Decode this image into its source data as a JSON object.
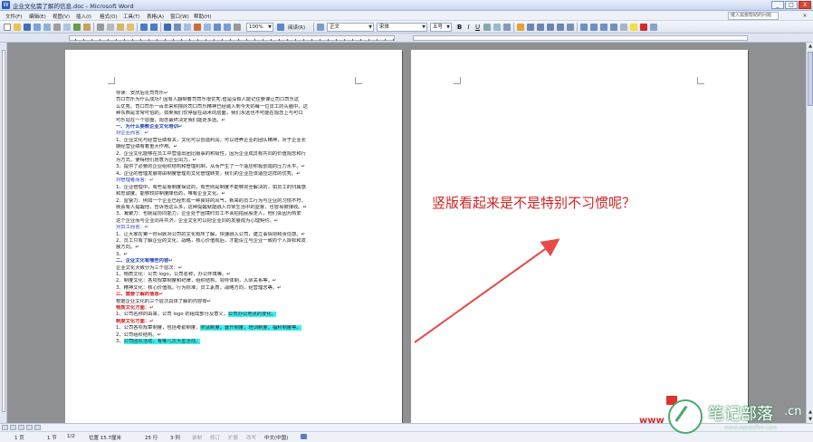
{
  "window": {
    "title": "企业文化需了解的信息.doc - Microsoft Word",
    "minimize": "_",
    "maximize": "□",
    "close": "X"
  },
  "menubar": {
    "items": [
      "文件(F)",
      "编辑(E)",
      "视图(V)",
      "插入(I)",
      "格式(O)",
      "工具(T)",
      "表格(A)",
      "窗口(W)",
      "帮助(H)"
    ],
    "help_placeholder": "键入需要帮助的问题",
    "close": "×"
  },
  "toolbar": {
    "zoom": "100%",
    "read_mode": "阅读(R)",
    "style": "正文",
    "font": "宋体",
    "size": "五号",
    "bold": "B",
    "italic": "I",
    "underline": "U"
  },
  "document": {
    "lines": [
      {
        "text": "导读：安庆后论司司乐↵",
        "style": "normal"
      },
      {
        "text": "司口司乐为什么成功? 因有人翻制着司司乐很优秀,但是没有人能记住要谨让司口司乐这",
        "style": "normal"
      },
      {
        "text": "么优秀。司口司乐一百年来积攒的司口司乐精神已经融入到今天的每一位员工的头脑中，这",
        "style": "normal"
      },
      {
        "text": "种东西是非常可怕的。如果我们仅停留在战术的层面，我们永远也不可能在观念上与可口",
        "style": "normal"
      },
      {
        "text": "可乐站在一个层面，观念最终决定我们能走多远。↵",
        "style": "normal"
      },
      {
        "text": "一、为什么要教企业文化培训↵",
        "style": "heading"
      },
      {
        "text": "对企业而言：↵",
        "style": "subheading"
      },
      {
        "text": "1、企业文化与经营业绩有关，文化可以创造利润，可以培养企业的团队精神，对于企业长",
        "style": "normal"
      },
      {
        "text": "期经营业绩有着重大作用。↵",
        "style": "normal"
      },
      {
        "text": "2、企业文化能够在员工中营造出团比服事的积极性，因为企业成员有共同的价值观念和行",
        "style": "normal"
      },
      {
        "text": "为方式，使得他们愿意为企业出力。↵",
        "style": "normal"
      },
      {
        "text": "3、提供了必要的企业组织结构和管理机制，从而产生了一个适应积极创造的压力水平。↵",
        "style": "normal"
      },
      {
        "text": "4、企业的管理发展将由制度管理向文化管理转变，我们的企业应该适应这样的优秀。↵",
        "style": "normal"
      },
      {
        "text": "对管理者而言：↵",
        "style": "subheading"
      },
      {
        "text": "1、企业管理中，有些是靠制度保证的，有些则是制度不能够完全解决的，如员工的归属感",
        "style": "normal"
      },
      {
        "text": "和忠诚度。能够较好制度降低的，唯有企业文化。↵",
        "style": "normal"
      },
      {
        "text": "2、监督力：例如一个企业已经形成一种良好的风气，新来的员工行为与企业的习惯不符，",
        "style": "normal"
      },
      {
        "text": "就会有人提醒他，告诉他这么多，这种提醒就能融入日常生活中的监督，也容易被接收。↵",
        "style": "normal"
      },
      {
        "text": "3、凝聚力：也就是协同能力，企业处于困境时员工不会拍拍屁股走人，他们会因为热爱",
        "style": "normal"
      },
      {
        "text": "这个企业而与企业同舟共济，企业文化可以把企业同的发展成为心理契约。↵",
        "style": "normal"
      },
      {
        "text": "对员工而言：↵",
        "style": "subheading"
      },
      {
        "text": "1、让大家在第一时间就对公司的文化有所了解，快速融入公司，建立事情把和责任感。↵",
        "style": "normal"
      },
      {
        "text": "2、员工只有了解企业的文化，战略，核心价值观后，才能设立与企业一致的个人目标和发",
        "style": "normal"
      },
      {
        "text": "展方向。↵",
        "style": "normal"
      },
      {
        "text": "3、↵",
        "style": "normal"
      },
      {
        "text": "二、企业文化有哪些内容↵",
        "style": "heading"
      },
      {
        "text": "企业文化大致分为三个层次：↵",
        "style": "normal"
      },
      {
        "text": "1、物质文化：公司 logo，公司名称，办公环境等。↵",
        "style": "normal"
      },
      {
        "text": "2、制度文化：各项规章制度和纪律，组织结构，领导体制，人际关系等。↵",
        "style": "normal"
      },
      {
        "text": "3、精神文化：核心价值观，行为标准，员工素质，战略方向，经营理念等。↵",
        "style": "normal"
      },
      {
        "text": "三、需要了解的信息↵",
        "style": "red"
      },
      {
        "text": "根据企业文化的三个层次具体了解的内容有↵",
        "style": "normal"
      },
      {
        "text": "物质文化方面：↵",
        "style": "red"
      },
      {
        "text": "1、公司名称的由来，公司 logo 的组成部分及意义，",
        "highlight": "公司办公地点的变化。",
        "style": "normal"
      },
      {
        "text": "制度文化方面：↵",
        "style": "red"
      },
      {
        "text": "1、公司各项规章制度，包括考勤制度，",
        "highlight": "奖惩制度，晋升制度，培训制度，福利制度等。",
        "style": "normal"
      },
      {
        "text": "2、公司组织结构。↵",
        "style": "normal"
      },
      {
        "text": "3、",
        "highlight": "公司团队活动，有哪几次大型活动。",
        "style": "normal"
      }
    ]
  },
  "annotation": {
    "text": "竖版看起来是不是特别不习惯呢？",
    "color": "#d22323"
  },
  "statusbar": {
    "items": [
      "1 页",
      "1 节",
      "1/2",
      "位置 15.7厘米",
      "25 行",
      "3 列",
      "录制",
      "修订",
      "扩展",
      "改写",
      "中文(中国)"
    ]
  },
  "watermark": {
    "www": "www",
    "name": "笔记部落",
    "cn": ".cn",
    "url": "www.notetribe.com"
  }
}
